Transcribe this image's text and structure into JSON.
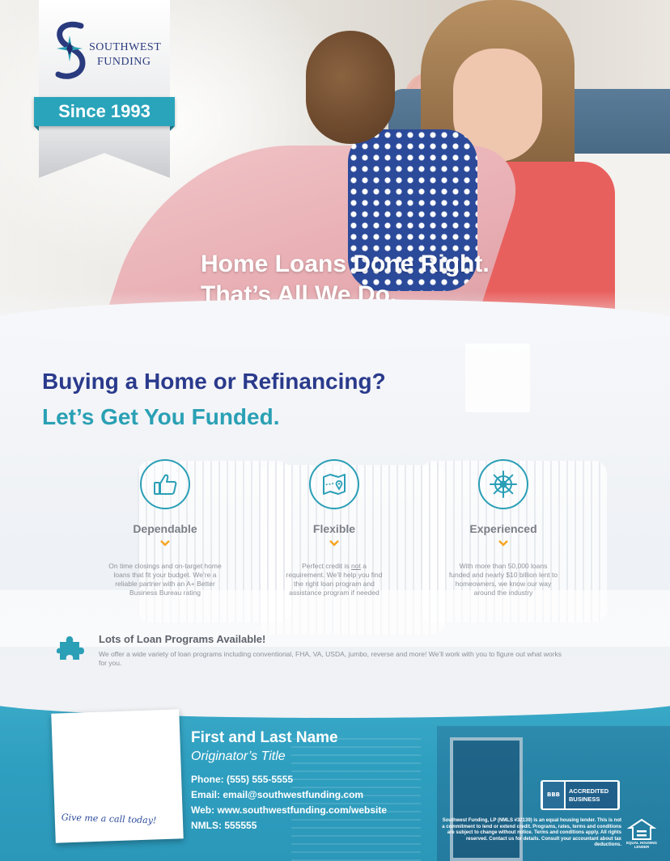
{
  "brand": {
    "name_line1": "SOUTHWEST",
    "name_line2": "FUNDING",
    "since": "Since 1993"
  },
  "hero": {
    "headline_line1": "Home Loans Done Right.",
    "headline_line2": "That’s All We Do."
  },
  "intro": {
    "question": "Buying a Home or Refinancing?",
    "tagline": "Let’s Get You Funded."
  },
  "features": [
    {
      "icon": "thumbs-up-icon",
      "title": "Dependable",
      "description": "On time closings and on-target home loans that fit your budget. We’re a reliable partner with an A+ Better Business Bureau rating"
    },
    {
      "icon": "map-location-icon",
      "title": "Flexible",
      "description_pre": "Perfect credit is ",
      "description_emph": "not",
      "description_post": " a requirement. We’ll help you find the right loan program and assistance program if needed"
    },
    {
      "icon": "ship-wheel-icon",
      "title": "Experienced",
      "description": "With more than 50,000 loans funded and nearly $10 billion lent to homeowners, we know our way around the industry"
    }
  ],
  "programs": {
    "title": "Lots of Loan Programs Available!",
    "description": "We offer a wide variety of loan programs including conventional, FHA, VA, USDA, jumbo, reverse and more! We’ll work with you to figure out what works for you."
  },
  "contact": {
    "note_text": "Give me a call today!",
    "name": "First and Last Name",
    "title": "Originator’s Title",
    "phone_label": "Phone:",
    "phone": "(555) 555-5555",
    "email_label": "Email:",
    "email": "email@southwestfunding.com",
    "web_label": "Web:",
    "web": "www.southwestfunding.com/website",
    "nmls_label": "NMLS:",
    "nmls": "555555"
  },
  "bbb": {
    "seal": "BBB",
    "label_line1": "ACCREDITED",
    "label_line2": "BUSINESS"
  },
  "legal": {
    "text": "Southwest Funding, LP (NMLS #32139) is an equal housing lender. This is not a commitment to lend or extend credit. Programs, rates, terms and conditions are subject to change without notice. Terms and conditions apply. All rights reserved. Contact us for details. Consult your accountant about tax deductions.",
    "ehl_label": "EQUAL HOUSING LENDER"
  },
  "colors": {
    "navy": "#2a3a8c",
    "teal": "#2aa0b4",
    "footer": "#2f9fc0"
  }
}
